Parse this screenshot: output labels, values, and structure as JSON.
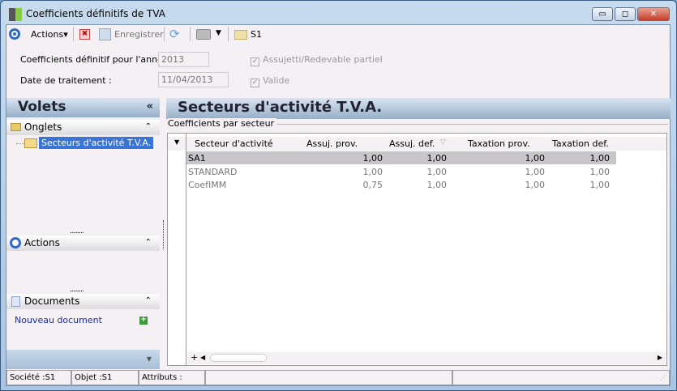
{
  "window": {
    "title": "Coefficients définitifs de TVA",
    "minimize": "▭",
    "restore": "◻",
    "close": "✕"
  },
  "toolbar": {
    "actions": "Actions",
    "save": "Enregistrer",
    "folder_label": "S1"
  },
  "form": {
    "year_label": "Coefficients définitif pour l'année :",
    "year_value": "2013",
    "date_label": "Date de traitement :",
    "date_value": "11/04/2013",
    "assujetti_label": "Assujetti/Redevable partiel",
    "valide_label": "Valide"
  },
  "left": {
    "title": "Volets",
    "onglets": "Onglets",
    "tree_item": "Secteurs d'activité T.V.A.",
    "actions": "Actions",
    "documents": "Documents",
    "new_doc": "Nouveau document"
  },
  "main": {
    "title": "Secteurs d'activité T.V.A.",
    "group": "Coefficients par secteur",
    "columns": [
      "Secteur d'activité",
      "Assuj. prov.",
      "Assuj. def.",
      "Taxation prov.",
      "Taxation def."
    ],
    "rows": [
      [
        "SA1",
        "1,00",
        "1,00",
        "1,00",
        "1,00"
      ],
      [
        "STANDARD",
        "1,00",
        "1,00",
        "1,00",
        "1,00"
      ],
      [
        "CoefIMM",
        "0,75",
        "1,00",
        "1,00",
        "1,00"
      ]
    ]
  },
  "status": {
    "societe": "Société :S1",
    "objet": "Objet :S1",
    "attributs": "Attributs :"
  }
}
